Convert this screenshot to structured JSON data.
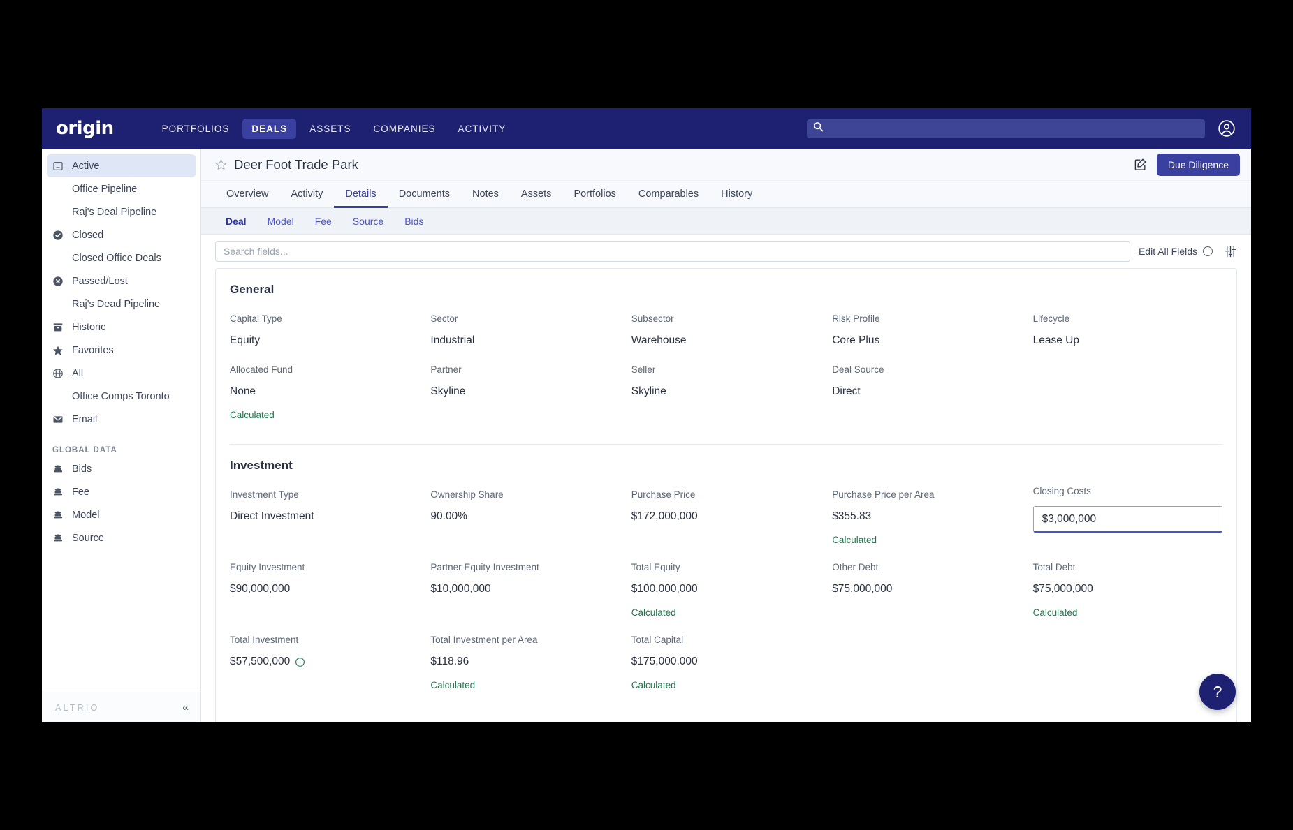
{
  "topnav": {
    "logo": "origin",
    "links": [
      {
        "label": "PORTFOLIOS",
        "active": false
      },
      {
        "label": "DEALS",
        "active": true
      },
      {
        "label": "ASSETS",
        "active": false
      },
      {
        "label": "COMPANIES",
        "active": false
      },
      {
        "label": "ACTIVITY",
        "active": false
      }
    ],
    "search_value": "",
    "search_placeholder": "",
    "search_icon": "search-icon",
    "avatar_icon": "user-account-icon"
  },
  "sidebar": {
    "items": [
      {
        "label": "Active",
        "icon": "inbox-icon",
        "sub": false,
        "selected": true
      },
      {
        "label": "Office Pipeline",
        "icon": "",
        "sub": true,
        "selected": false
      },
      {
        "label": "Raj's Deal Pipeline",
        "icon": "",
        "sub": true,
        "selected": false
      },
      {
        "label": "Closed",
        "icon": "check-badge-icon",
        "sub": false,
        "selected": false
      },
      {
        "label": "Closed Office Deals",
        "icon": "",
        "sub": true,
        "selected": false
      },
      {
        "label": "Passed/Lost",
        "icon": "x-badge-icon",
        "sub": false,
        "selected": false
      },
      {
        "label": "Raj's Dead Pipeline",
        "icon": "",
        "sub": true,
        "selected": false
      },
      {
        "label": "Historic",
        "icon": "archive-icon",
        "sub": false,
        "selected": false
      },
      {
        "label": "Favorites",
        "icon": "star-filled-icon",
        "sub": false,
        "selected": false
      },
      {
        "label": "All",
        "icon": "globe-icon",
        "sub": false,
        "selected": false
      },
      {
        "label": "Office Comps Toronto",
        "icon": "",
        "sub": true,
        "selected": false
      },
      {
        "label": "Email",
        "icon": "envelope-icon",
        "sub": false,
        "selected": false
      }
    ],
    "group_label": "GLOBAL DATA",
    "global_items": [
      {
        "label": "Bids",
        "icon": "database-icon"
      },
      {
        "label": "Fee",
        "icon": "database-icon"
      },
      {
        "label": "Model",
        "icon": "database-icon"
      },
      {
        "label": "Source",
        "icon": "database-icon"
      }
    ],
    "footer_brand": "ALTRIO",
    "collapse_icon": "chevron-double-left-icon"
  },
  "page_header": {
    "star_icon": "star-outline-icon",
    "title": "Deer Foot Trade Park",
    "edit_icon": "edit-square-icon",
    "due_diligence_button": "Due Diligence"
  },
  "tabs": [
    {
      "label": "Overview",
      "active": false
    },
    {
      "label": "Activity",
      "active": false
    },
    {
      "label": "Details",
      "active": true
    },
    {
      "label": "Documents",
      "active": false
    },
    {
      "label": "Notes",
      "active": false
    },
    {
      "label": "Assets",
      "active": false
    },
    {
      "label": "Portfolios",
      "active": false
    },
    {
      "label": "Comparables",
      "active": false
    },
    {
      "label": "History",
      "active": false
    }
  ],
  "subtabs": [
    {
      "label": "Deal",
      "active": true
    },
    {
      "label": "Model",
      "active": false
    },
    {
      "label": "Fee",
      "active": false
    },
    {
      "label": "Source",
      "active": false
    },
    {
      "label": "Bids",
      "active": false
    }
  ],
  "toolbar": {
    "search_value": "",
    "search_placeholder": "Search fields...",
    "edit_all_fields_label": "Edit All Fields",
    "toggle_icon": "toggle-circle-icon",
    "filter_icon": "sliders-icon"
  },
  "sections": [
    {
      "title": "General",
      "rows": [
        [
          {
            "label": "Capital Type",
            "value": "Equity",
            "calculated": "",
            "input": false
          },
          {
            "label": "Sector",
            "value": "Industrial",
            "calculated": "",
            "input": false
          },
          {
            "label": "Subsector",
            "value": "Warehouse",
            "calculated": "",
            "input": false
          },
          {
            "label": "Risk Profile",
            "value": "Core Plus",
            "calculated": "",
            "input": false
          },
          {
            "label": "Lifecycle",
            "value": "Lease Up",
            "calculated": "",
            "input": false
          }
        ],
        [
          {
            "label": "Allocated Fund",
            "value": "None",
            "calculated": "Calculated",
            "input": false
          },
          {
            "label": "Partner",
            "value": "Skyline",
            "calculated": "",
            "input": false
          },
          {
            "label": "Seller",
            "value": "Skyline",
            "calculated": "",
            "input": false
          },
          {
            "label": "Deal Source",
            "value": "Direct",
            "calculated": "",
            "input": false
          },
          {
            "label": "",
            "value": "",
            "calculated": "",
            "input": false
          }
        ]
      ]
    },
    {
      "title": "Investment",
      "rows": [
        [
          {
            "label": "Investment Type",
            "value": "Direct Investment",
            "calculated": "",
            "input": false
          },
          {
            "label": "Ownership Share",
            "value": "90.00%",
            "calculated": "",
            "input": false
          },
          {
            "label": "Purchase Price",
            "value": "$172,000,000",
            "calculated": "",
            "input": false
          },
          {
            "label": "Purchase Price per Area",
            "value": "$355.83",
            "calculated": "Calculated",
            "input": false
          },
          {
            "label": "Closing Costs",
            "value": "$3,000,000",
            "calculated": "",
            "input": true
          }
        ],
        [
          {
            "label": "Equity Investment",
            "value": "$90,000,000",
            "calculated": "",
            "input": false
          },
          {
            "label": "Partner Equity Investment",
            "value": "$10,000,000",
            "calculated": "",
            "input": false
          },
          {
            "label": "Total Equity",
            "value": "$100,000,000",
            "calculated": "Calculated",
            "input": false
          },
          {
            "label": "Other Debt",
            "value": "$75,000,000",
            "calculated": "",
            "input": false
          },
          {
            "label": "Total Debt",
            "value": "$75,000,000",
            "calculated": "Calculated",
            "input": false
          }
        ],
        [
          {
            "label": "Total Investment",
            "value": "$57,500,000",
            "calculated": "",
            "input": false,
            "info": true
          },
          {
            "label": "Total Investment per Area",
            "value": "$118.96",
            "calculated": "Calculated",
            "input": false
          },
          {
            "label": "Total Capital",
            "value": "$175,000,000",
            "calculated": "Calculated",
            "input": false
          },
          {
            "label": "",
            "value": "",
            "calculated": "",
            "input": false
          },
          {
            "label": "",
            "value": "",
            "calculated": "",
            "input": false
          }
        ]
      ]
    }
  ],
  "help": {
    "label": "?",
    "icon": "question-mark-icon"
  },
  "colors": {
    "nav_bg": "#1e2171",
    "accent": "#3a40a0",
    "link": "#4a52d4",
    "calculated_green": "#1d7a4c",
    "sidebar_selected": "#dfe6f5"
  }
}
